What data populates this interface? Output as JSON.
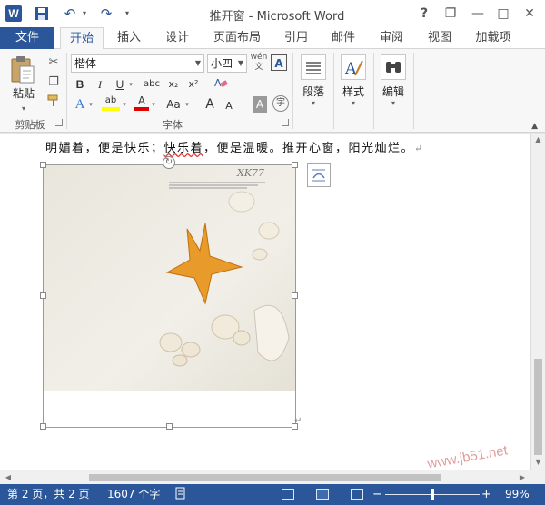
{
  "app": {
    "logo_letter": "W",
    "title": "推开窗 - Microsoft Word"
  },
  "quick_access": {
    "save_icon": "save-icon",
    "undo_icon": "undo-icon",
    "redo_icon": "redo-icon"
  },
  "window_controls": {
    "help": "?",
    "minimize": "—",
    "restore": "❐",
    "close": "✕"
  },
  "ribbon_tabs": [
    "文件",
    "开始",
    "插入",
    "设计",
    "页面布局",
    "引用",
    "邮件",
    "审阅",
    "视图",
    "加载项"
  ],
  "active_tab_index": 1,
  "clipboard": {
    "paste_label": "粘贴",
    "group_label": "剪贴板"
  },
  "font": {
    "font_name": "楷体",
    "font_size": "小四",
    "wen_label": "wén 文",
    "border_a": "A",
    "bold": "B",
    "italic": "I",
    "underline": "U",
    "strikethrough": "abc",
    "subscript": "x₂",
    "superscript": "x²",
    "text_effects": "A",
    "highlight": "ab",
    "font_color": "A",
    "change_case": "Aa",
    "grow_font": "A",
    "shrink_font": "A",
    "char_shading": "A",
    "enclose_char": "字",
    "group_label": "字体"
  },
  "paragraph": {
    "label": "段落"
  },
  "styles": {
    "label": "样式"
  },
  "editing": {
    "label": "编辑"
  },
  "document": {
    "line_part1": "明媚着，便是快乐；",
    "line_squiggle": "快乐着",
    "line_part2": "，便是温暖。推开心窗，阳光灿烂。",
    "para_mark": "↵",
    "image_caption": "XK77",
    "anchor_mark": "↵"
  },
  "statusbar": {
    "page_info": "第 2 页，共 2 页",
    "word_count": "1607 个字",
    "proofing_icon": "proofing-icon",
    "zoom_minus": "−",
    "zoom_plus": "+",
    "zoom_level": "99%",
    "zoom_fraction": 0.5
  },
  "watermark": "www.jb51.net",
  "colors": {
    "brand": "#2b579a",
    "highlight_yellow": "#ffff00",
    "font_red": "#e00000",
    "starfish": "#e89a2a"
  }
}
